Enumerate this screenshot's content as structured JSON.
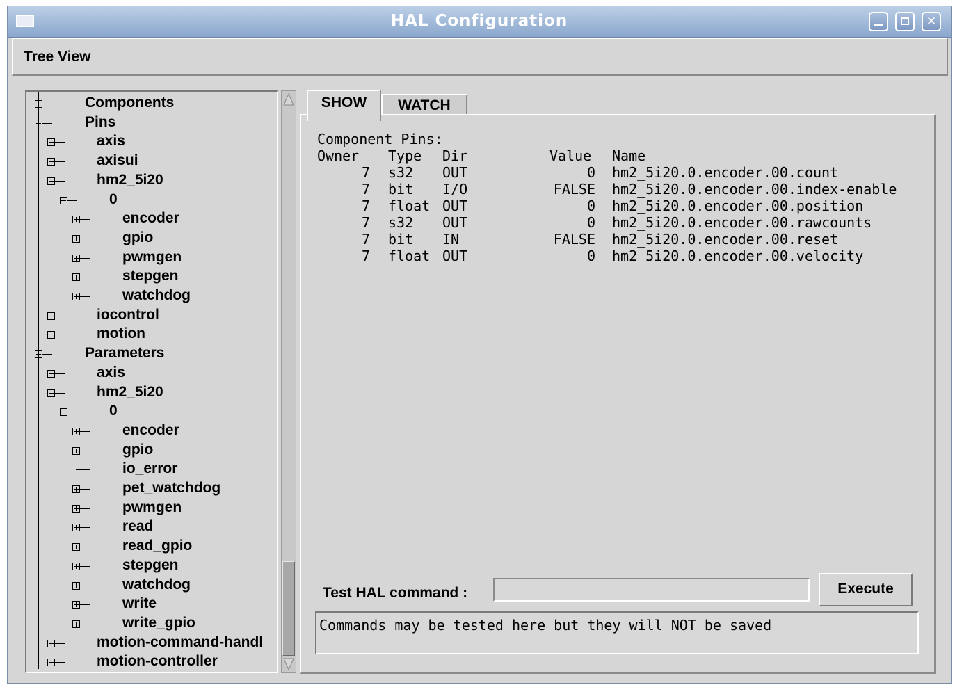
{
  "window": {
    "title": "HAL Configuration"
  },
  "menu": {
    "tree_view": "Tree View"
  },
  "tree": {
    "rows": [
      {
        "label": "Components",
        "level": 0,
        "state": "plus"
      },
      {
        "label": "Pins",
        "level": 0,
        "state": "minus"
      },
      {
        "label": "axis",
        "level": 1,
        "state": "plus"
      },
      {
        "label": "axisui",
        "level": 1,
        "state": "plus"
      },
      {
        "label": "hm2_5i20",
        "level": 1,
        "state": "minus"
      },
      {
        "label": "0",
        "level": 2,
        "state": "minus"
      },
      {
        "label": "encoder",
        "level": 3,
        "state": "plus"
      },
      {
        "label": "gpio",
        "level": 3,
        "state": "plus"
      },
      {
        "label": "pwmgen",
        "level": 3,
        "state": "plus"
      },
      {
        "label": "stepgen",
        "level": 3,
        "state": "plus"
      },
      {
        "label": "watchdog",
        "level": 3,
        "state": "plus"
      },
      {
        "label": "iocontrol",
        "level": 1,
        "state": "plus"
      },
      {
        "label": "motion",
        "level": 1,
        "state": "plus"
      },
      {
        "label": "Parameters",
        "level": 0,
        "state": "minus"
      },
      {
        "label": "axis",
        "level": 1,
        "state": "plus"
      },
      {
        "label": "hm2_5i20",
        "level": 1,
        "state": "minus"
      },
      {
        "label": "0",
        "level": 2,
        "state": "minus"
      },
      {
        "label": "encoder",
        "level": 3,
        "state": "plus"
      },
      {
        "label": "gpio",
        "level": 3,
        "state": "plus"
      },
      {
        "label": "io_error",
        "level": 3,
        "state": "leaf"
      },
      {
        "label": "pet_watchdog",
        "level": 3,
        "state": "plus"
      },
      {
        "label": "pwmgen",
        "level": 3,
        "state": "plus"
      },
      {
        "label": "read",
        "level": 3,
        "state": "plus"
      },
      {
        "label": "read_gpio",
        "level": 3,
        "state": "plus"
      },
      {
        "label": "stepgen",
        "level": 3,
        "state": "plus"
      },
      {
        "label": "watchdog",
        "level": 3,
        "state": "plus"
      },
      {
        "label": "write",
        "level": 3,
        "state": "plus"
      },
      {
        "label": "write_gpio",
        "level": 3,
        "state": "plus"
      },
      {
        "label": "motion-command-handl",
        "level": 1,
        "state": "plus"
      },
      {
        "label": "motion-controller",
        "level": 1,
        "state": "plus"
      }
    ]
  },
  "tabs": {
    "show": "SHOW",
    "watch": "WATCH"
  },
  "show": {
    "heading": "Component Pins:",
    "columns": {
      "owner": "Owner",
      "type": "Type",
      "dir": "Dir",
      "value": "Value",
      "name": "Name"
    },
    "rows": [
      {
        "owner": "7",
        "type": "s32",
        "dir": "OUT",
        "value": "0",
        "name": "hm2_5i20.0.encoder.00.count"
      },
      {
        "owner": "7",
        "type": "bit",
        "dir": "I/O",
        "value": "FALSE",
        "name": "hm2_5i20.0.encoder.00.index-enable"
      },
      {
        "owner": "7",
        "type": "float",
        "dir": "OUT",
        "value": "0",
        "name": "hm2_5i20.0.encoder.00.position"
      },
      {
        "owner": "7",
        "type": "s32",
        "dir": "OUT",
        "value": "0",
        "name": "hm2_5i20.0.encoder.00.rawcounts"
      },
      {
        "owner": "7",
        "type": "bit",
        "dir": "IN",
        "value": "FALSE",
        "name": "hm2_5i20.0.encoder.00.reset"
      },
      {
        "owner": "7",
        "type": "float",
        "dir": "OUT",
        "value": "0",
        "name": "hm2_5i20.0.encoder.00.velocity"
      }
    ]
  },
  "command": {
    "label": "Test HAL command :",
    "value": "",
    "execute": "Execute",
    "output": "Commands may be tested here but they will NOT be saved"
  },
  "colors": {
    "titlebar": "#8aa7cd",
    "window_bg": "#d6d6d6"
  }
}
